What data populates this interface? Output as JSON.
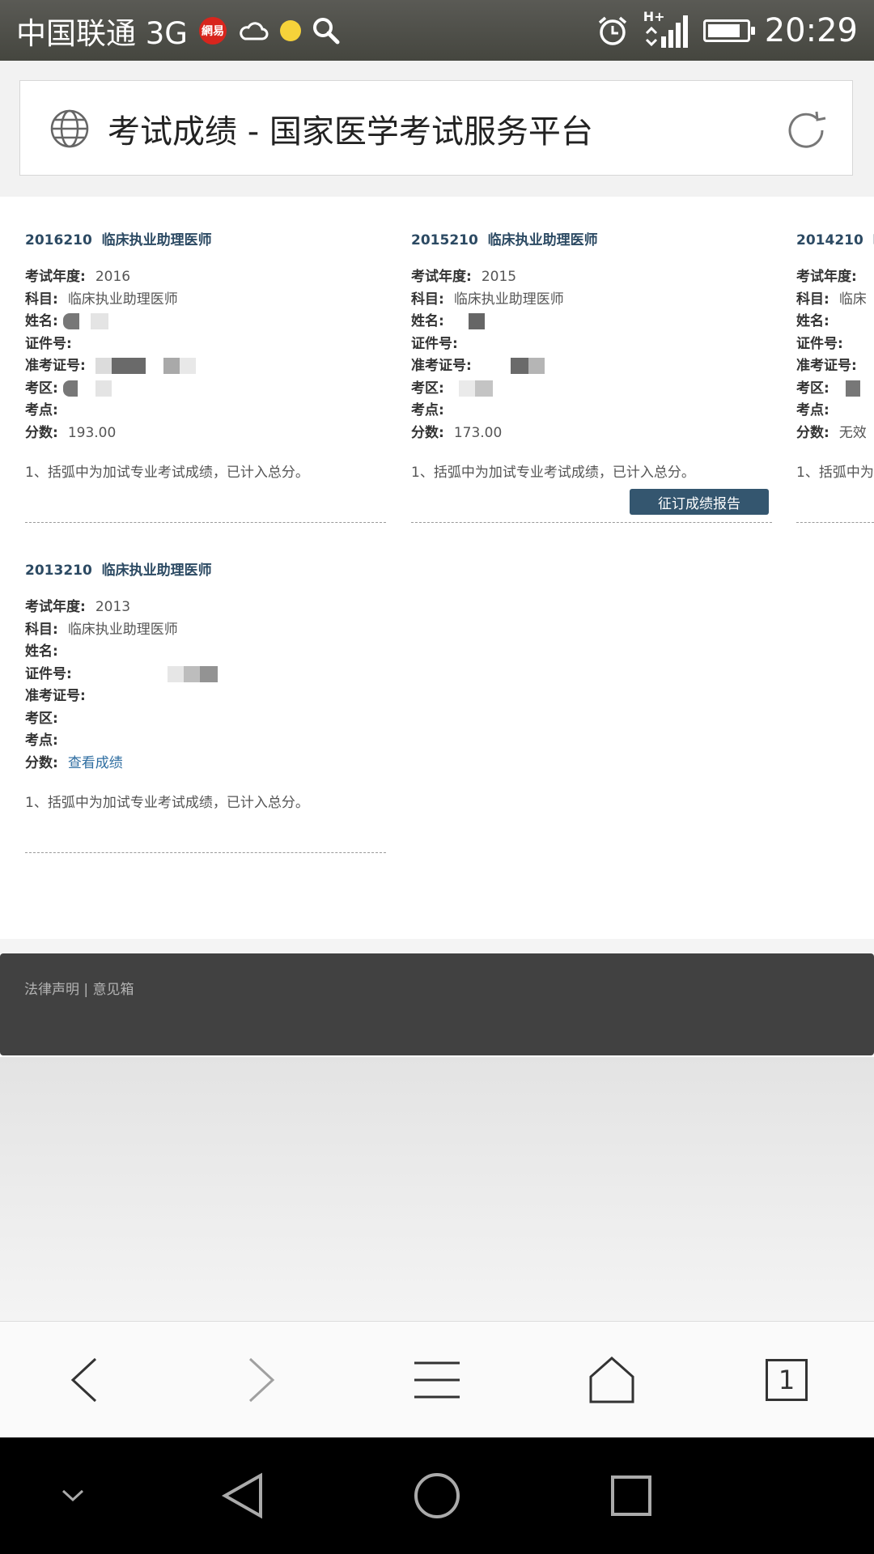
{
  "status_bar": {
    "carrier": "中国联通 3G",
    "netease_badge": "網易",
    "time": "20:29",
    "network": "H+",
    "battery_level": 0.85,
    "icons": [
      "netease-icon",
      "cloud-icon",
      "sun-icon",
      "search-icon",
      "alarm-icon",
      "signal-icon",
      "battery-icon"
    ]
  },
  "address_bar": {
    "title": "考试成绩 - 国家医学考试服务平台",
    "icons": [
      "globe-icon",
      "refresh-icon"
    ]
  },
  "labels": {
    "year": "考试年度:",
    "subject": "科目:",
    "name": "姓名:",
    "id_number": "证件号:",
    "ticket_number": "准考证号:",
    "exam_area": "考区:",
    "exam_site": "考点:",
    "score": "分数:"
  },
  "cards": [
    {
      "code": "2016210",
      "title": "临床执业助理医师",
      "year": "2016",
      "subject": "临床执业助理医师",
      "score": "193.00",
      "note": "1、括弧中为加试专业考试成绩，已计入总分。"
    },
    {
      "code": "2015210",
      "title": "临床执业助理医师",
      "year": "2015",
      "subject": "临床执业助理医师",
      "score": "173.00",
      "note": "1、括弧中为加试专业考试成绩，已计入总分。",
      "button": "征订成绩报告"
    },
    {
      "code": "2014210",
      "title": "临",
      "year": "",
      "subject": "临床",
      "score": "无效",
      "note": "1、括弧中为"
    },
    {
      "code": "2013210",
      "title": "临床执业助理医师",
      "year": "2013",
      "subject": "临床执业助理医师",
      "score_link": "查看成绩",
      "note": "1、括弧中为加试专业考试成绩，已计入总分。"
    }
  ],
  "footer": {
    "legal": "法律声明",
    "separator": "|",
    "feedback": "意见箱"
  },
  "browser_toolbar": {
    "tab_count": "1",
    "icons": [
      "back-icon",
      "forward-icon",
      "menu-icon",
      "home-icon",
      "tabs-icon"
    ]
  },
  "nav_bar": {
    "icons": [
      "collapse-icon",
      "nav-back-icon",
      "nav-home-icon",
      "nav-recents-icon"
    ]
  },
  "colors": {
    "title_blue": "#2c4a63",
    "button_bg": "#34566f",
    "link_blue": "#2f6ea1",
    "footer_bg": "#414141"
  }
}
